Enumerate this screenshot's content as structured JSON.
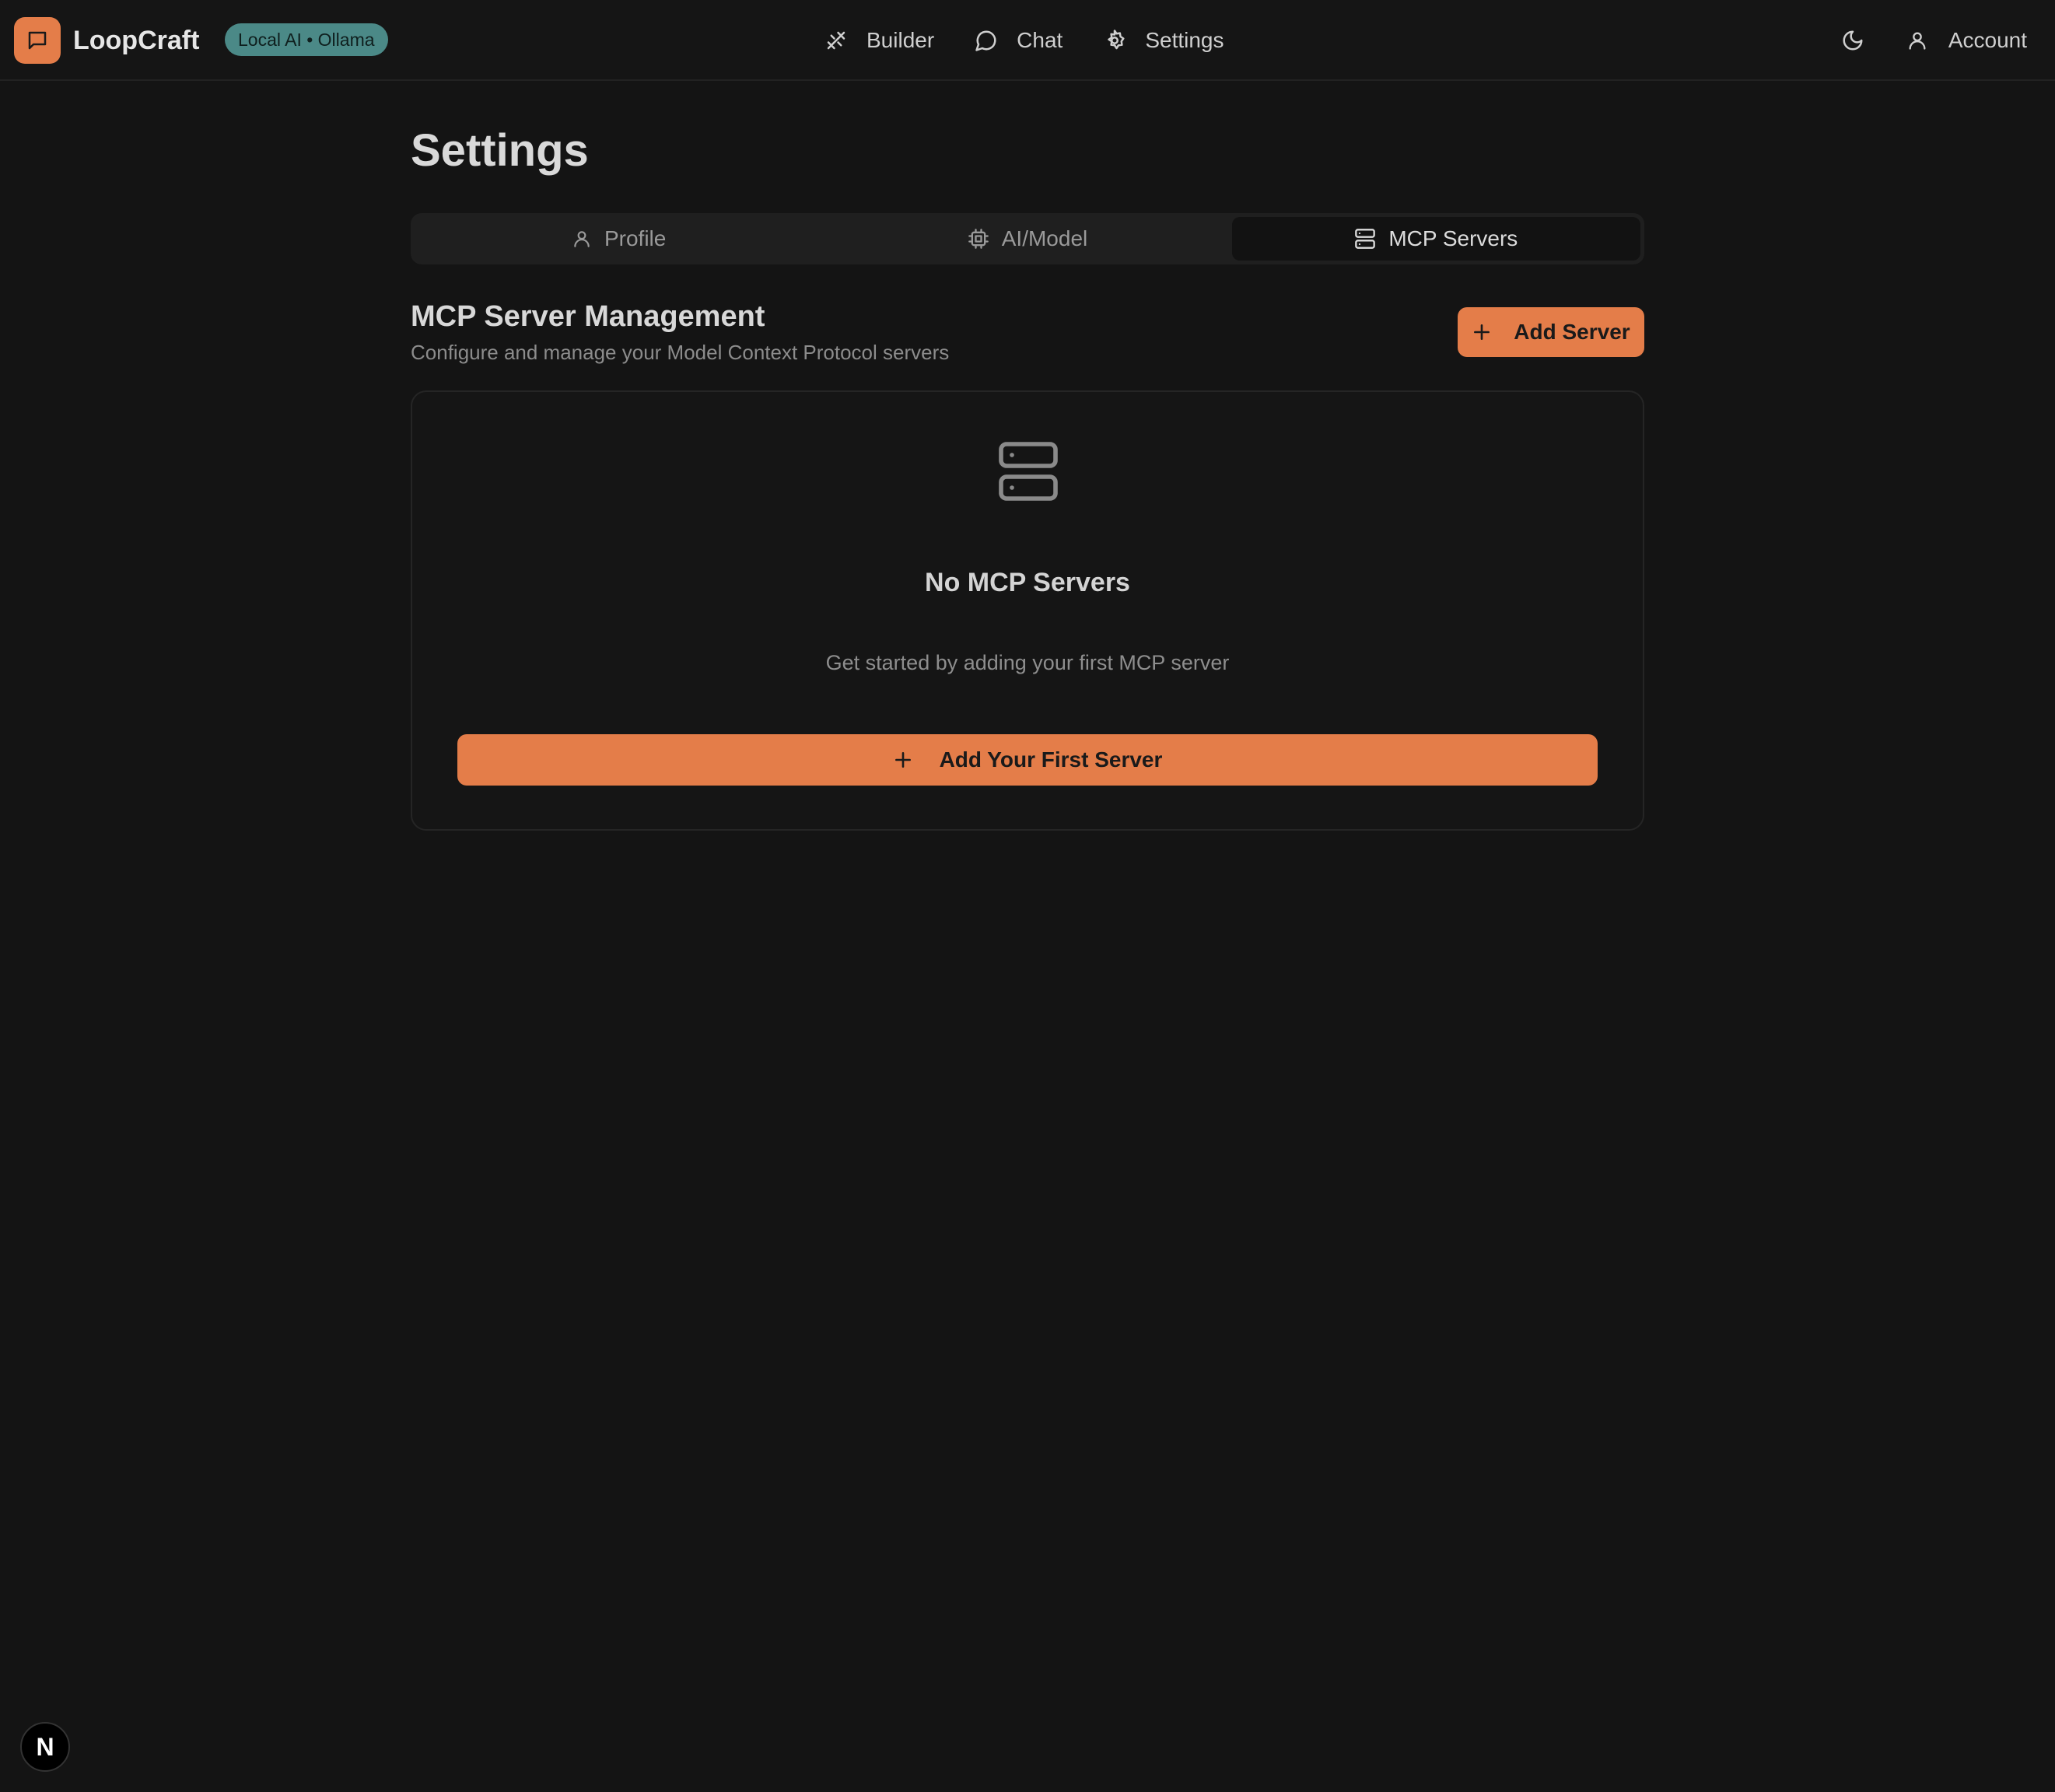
{
  "app": {
    "name": "LoopCraft",
    "badge": "Local AI • Ollama",
    "brand_color": "#e47d49",
    "badge_color": "#4b8987"
  },
  "nav": {
    "items": [
      {
        "label": "Builder",
        "icon": "builder-icon"
      },
      {
        "label": "Chat",
        "icon": "chat-icon"
      },
      {
        "label": "Settings",
        "icon": "gear-icon"
      }
    ],
    "theme_icon": "moon-icon",
    "account_label": "Account",
    "account_icon": "user-icon"
  },
  "page": {
    "title": "Settings"
  },
  "tabs": [
    {
      "label": "Profile",
      "icon": "user-icon",
      "active": false
    },
    {
      "label": "AI/Model",
      "icon": "cpu-icon",
      "active": false
    },
    {
      "label": "MCP Servers",
      "icon": "server-icon",
      "active": true
    }
  ],
  "section": {
    "title": "MCP Server Management",
    "subtitle": "Configure and manage your Model Context Protocol servers",
    "add_button": "Add Server"
  },
  "empty_state": {
    "icon": "server-icon",
    "title": "No MCP Servers",
    "subtitle": "Get started by adding your first MCP server",
    "button": "Add Your First Server"
  },
  "dev_badge": {
    "label": "N"
  }
}
